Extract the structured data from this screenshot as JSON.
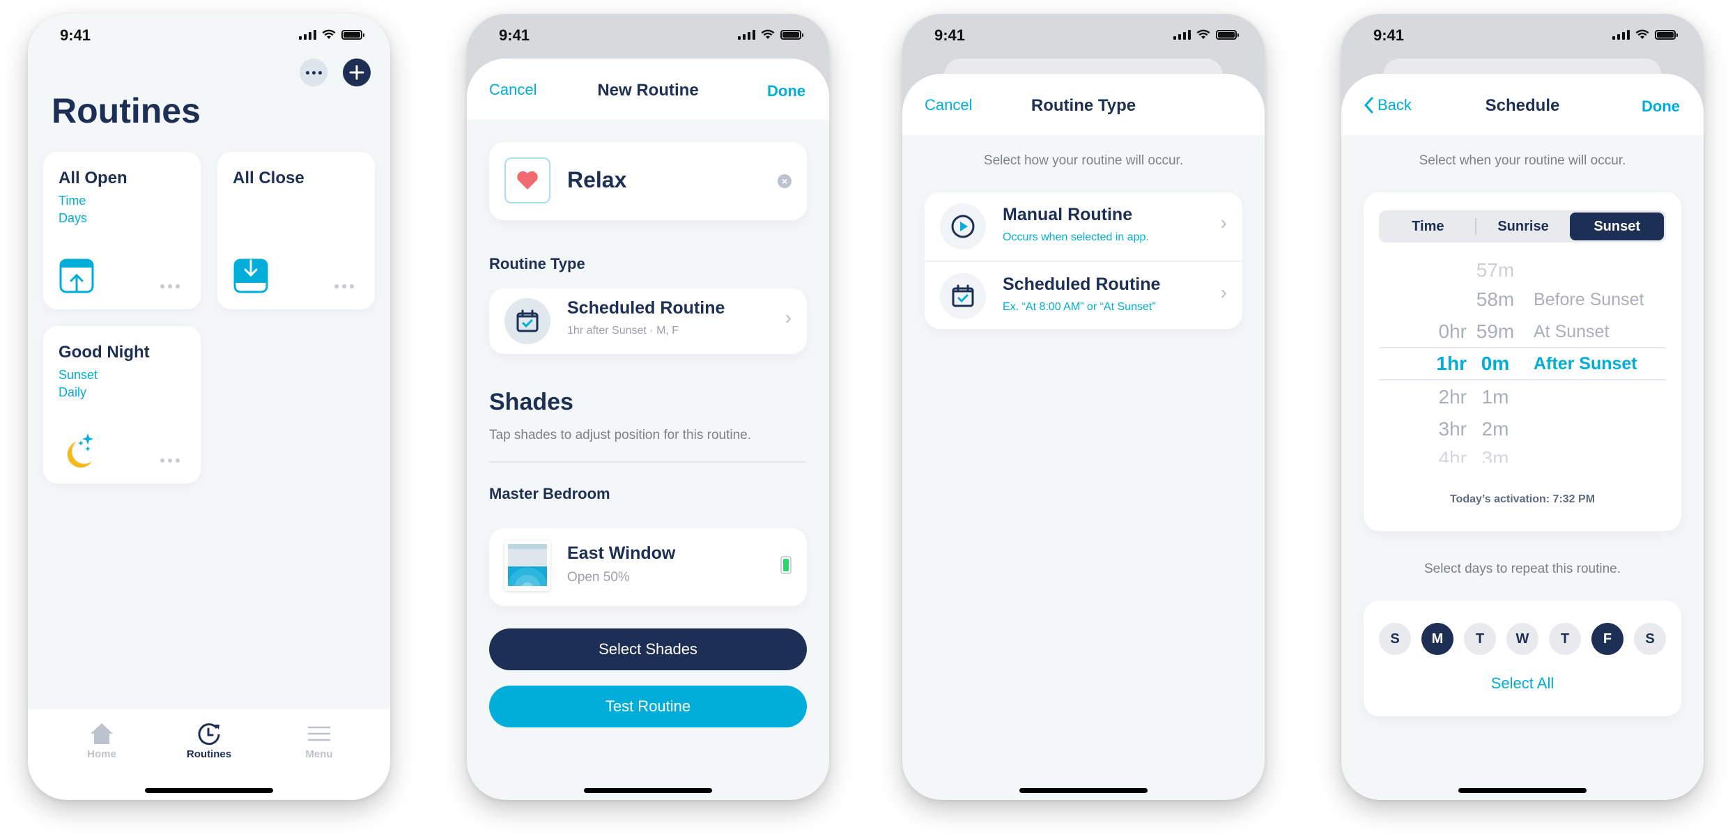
{
  "status_bar": {
    "time": "9:41"
  },
  "colors": {
    "navy": "#1d2f55",
    "accent": "#00aed9",
    "background": "#f4f7f8",
    "moon": "#fbb81b",
    "heart": "#ef6b6f",
    "battery": "#2fd46d"
  },
  "screen1": {
    "title": "Routines",
    "actions": {
      "more_icon": "ellipsis-icon",
      "add_icon": "plus-icon"
    },
    "routines": [
      {
        "name": "All Open",
        "details": [
          "Time",
          "Days"
        ],
        "icon": "shade-open-icon"
      },
      {
        "name": "All Close",
        "details": [],
        "icon": "shade-close-icon"
      },
      {
        "name": "Good Night",
        "details": [
          "Sunset",
          "Daily"
        ],
        "icon": "moon-stars-icon"
      }
    ],
    "tabs": [
      {
        "label": "Home",
        "icon": "home-icon",
        "active": false
      },
      {
        "label": "Routines",
        "icon": "clock-icon",
        "active": true
      },
      {
        "label": "Menu",
        "icon": "menu-icon",
        "active": false
      }
    ]
  },
  "screen2": {
    "nav": {
      "left": "Cancel",
      "title": "New Routine",
      "right": "Done"
    },
    "routine_name": "Relax",
    "routine_icon": "heart-icon",
    "routine_type_label": "Routine Type",
    "routine_type": {
      "title": "Scheduled Routine",
      "subtitle": "1hr after Sunset · M, F"
    },
    "shades_title": "Shades",
    "shades_hint": "Tap shades to adjust position for this routine.",
    "room": "Master Bedroom",
    "shade": {
      "name": "East Window",
      "status": "Open 50%",
      "open_percent": 50
    },
    "buttons": {
      "select_shades": "Select Shades",
      "test_routine": "Test Routine"
    }
  },
  "screen3": {
    "nav": {
      "left": "Cancel",
      "title": "Routine Type"
    },
    "hint": "Select how your routine will occur.",
    "options": [
      {
        "title": "Manual Routine",
        "subtitle": "Occurs when selected in app.",
        "icon": "play-circle-icon"
      },
      {
        "title": "Scheduled Routine",
        "subtitle": "Ex. “At 8:00 AM” or “At Sunset”",
        "icon": "calendar-check-icon"
      }
    ]
  },
  "screen4": {
    "nav": {
      "left": "Back",
      "title": "Schedule",
      "right": "Done"
    },
    "hint": "Select when your routine will occur.",
    "segments": [
      {
        "label": "Time",
        "active": false
      },
      {
        "label": "Sunrise",
        "active": false
      },
      {
        "label": "Sunset",
        "active": true
      }
    ],
    "picker": {
      "hours": [
        "0hr",
        "1hr",
        "2hr",
        "3hr",
        "4hr"
      ],
      "minutes": [
        "57m",
        "58m",
        "59m",
        "0m",
        "1m",
        "2m",
        "3m"
      ],
      "relation": [
        "Before Sunset",
        "At Sunset",
        "After Sunset"
      ],
      "selected": {
        "hour": "1hr",
        "minute": "0m",
        "relation": "After Sunset"
      }
    },
    "activation": "Today’s activation: 7:32 PM",
    "days_hint": "Select days to repeat this routine.",
    "days": [
      {
        "label": "S",
        "selected": false
      },
      {
        "label": "M",
        "selected": true
      },
      {
        "label": "T",
        "selected": false
      },
      {
        "label": "W",
        "selected": false
      },
      {
        "label": "T",
        "selected": false
      },
      {
        "label": "F",
        "selected": true
      },
      {
        "label": "S",
        "selected": false
      }
    ],
    "select_all": "Select All"
  }
}
